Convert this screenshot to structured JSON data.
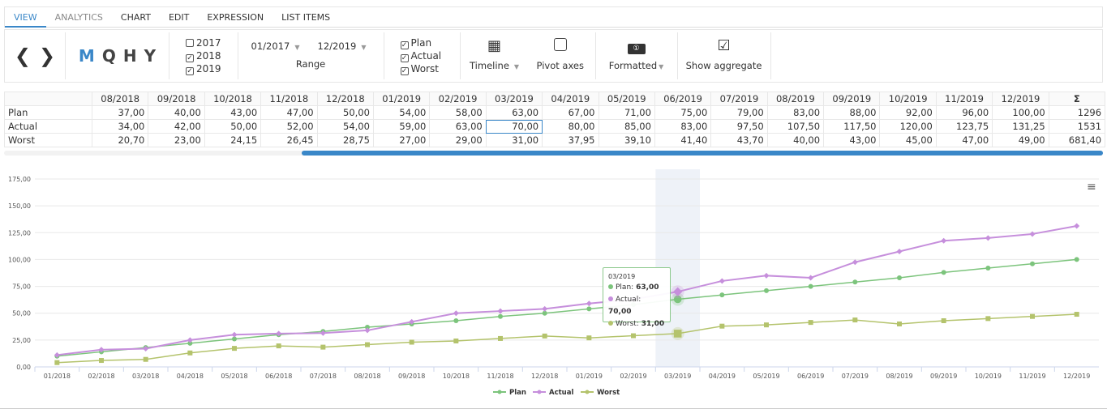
{
  "tabs": [
    "VIEW",
    "ANALYTICS",
    "CHART",
    "EDIT",
    "EXPRESSION",
    "LIST ITEMS"
  ],
  "toolbar": {
    "prev": "❮",
    "next": "❯",
    "periods": [
      "M",
      "Q",
      "H",
      "Y"
    ],
    "years": [
      {
        "label": "2017",
        "checked": false
      },
      {
        "label": "2018",
        "checked": true
      },
      {
        "label": "2019",
        "checked": true
      }
    ],
    "range_from": "01/2017",
    "range_to": "12/2019",
    "range_label": "Range",
    "series": [
      {
        "label": "Plan",
        "checked": true
      },
      {
        "label": "Actual",
        "checked": true
      },
      {
        "label": "Worst",
        "checked": true
      }
    ],
    "timeline": "Timeline",
    "pivot": "Pivot axes",
    "formatted": "Formatted",
    "aggregate": "Show aggregate"
  },
  "table": {
    "columns": [
      "08/2018",
      "09/2018",
      "10/2018",
      "11/2018",
      "12/2018",
      "01/2019",
      "02/2019",
      "03/2019",
      "04/2019",
      "05/2019",
      "06/2019",
      "07/2019",
      "08/2019",
      "09/2019",
      "10/2019",
      "11/2019",
      "12/2019",
      "Σ"
    ],
    "rows": [
      {
        "label": "Plan",
        "values": [
          "37,00",
          "40,00",
          "43,00",
          "47,00",
          "50,00",
          "54,00",
          "58,00",
          "63,00",
          "67,00",
          "71,00",
          "75,00",
          "79,00",
          "83,00",
          "88,00",
          "92,00",
          "96,00",
          "100,00",
          "1296"
        ]
      },
      {
        "label": "Actual",
        "values": [
          "34,00",
          "42,00",
          "50,00",
          "52,00",
          "54,00",
          "59,00",
          "63,00",
          "70,00",
          "80,00",
          "85,00",
          "83,00",
          "97,50",
          "107,50",
          "117,50",
          "120,00",
          "123,75",
          "131,25",
          "1531"
        ]
      },
      {
        "label": "Worst",
        "values": [
          "20,70",
          "23,00",
          "24,15",
          "26,45",
          "28,75",
          "27,00",
          "29,00",
          "31,00",
          "37,95",
          "39,10",
          "41,40",
          "43,70",
          "40,00",
          "43,00",
          "45,00",
          "47,00",
          "49,00",
          "681,40"
        ]
      }
    ]
  },
  "chart_data": {
    "type": "line",
    "categories": [
      "01/2018",
      "02/2018",
      "03/2018",
      "04/2018",
      "05/2018",
      "06/2018",
      "07/2018",
      "08/2018",
      "09/2018",
      "10/2018",
      "11/2018",
      "12/2018",
      "01/2019",
      "02/2019",
      "03/2019",
      "04/2019",
      "05/2019",
      "06/2019",
      "07/2019",
      "08/2019",
      "09/2019",
      "10/2019",
      "11/2019",
      "12/2019"
    ],
    "ylim": [
      0,
      175
    ],
    "yticks": [
      "0,00",
      "25,00",
      "50,00",
      "75,00",
      "100,00",
      "125,00",
      "150,00",
      "175,00"
    ],
    "grid": true,
    "legend": "bottom",
    "highlighted": "03/2019",
    "series": [
      {
        "name": "Plan",
        "color": "#7cc47c",
        "marker": "circle",
        "values": [
          10,
          14,
          18,
          22,
          26,
          30,
          33,
          37,
          40,
          43,
          47,
          50,
          54,
          58,
          63,
          67,
          71,
          75,
          79,
          83,
          88,
          92,
          96,
          100
        ]
      },
      {
        "name": "Actual",
        "color": "#c68fdc",
        "marker": "diamond",
        "values": [
          11,
          16,
          17,
          25,
          30,
          31,
          31.5,
          34,
          42,
          50,
          52,
          54,
          59,
          63,
          70,
          80,
          85,
          83,
          97.5,
          107.5,
          117.5,
          120,
          123.75,
          131.25
        ]
      },
      {
        "name": "Worst",
        "color": "#b4c36c",
        "marker": "square",
        "values": [
          4,
          6,
          7,
          13,
          17.25,
          19.55,
          18.4,
          20.7,
          23,
          24.15,
          26.45,
          28.75,
          27,
          29,
          31,
          37.95,
          39.1,
          41.4,
          43.7,
          40,
          43,
          45,
          47,
          49
        ]
      }
    ],
    "tooltip": {
      "title": "03/2019",
      "rows": [
        {
          "label": "Plan:",
          "value": "63,00"
        },
        {
          "label": "Actual:",
          "value": "70,00"
        },
        {
          "label": "Worst:",
          "value": "31,00"
        }
      ]
    }
  }
}
